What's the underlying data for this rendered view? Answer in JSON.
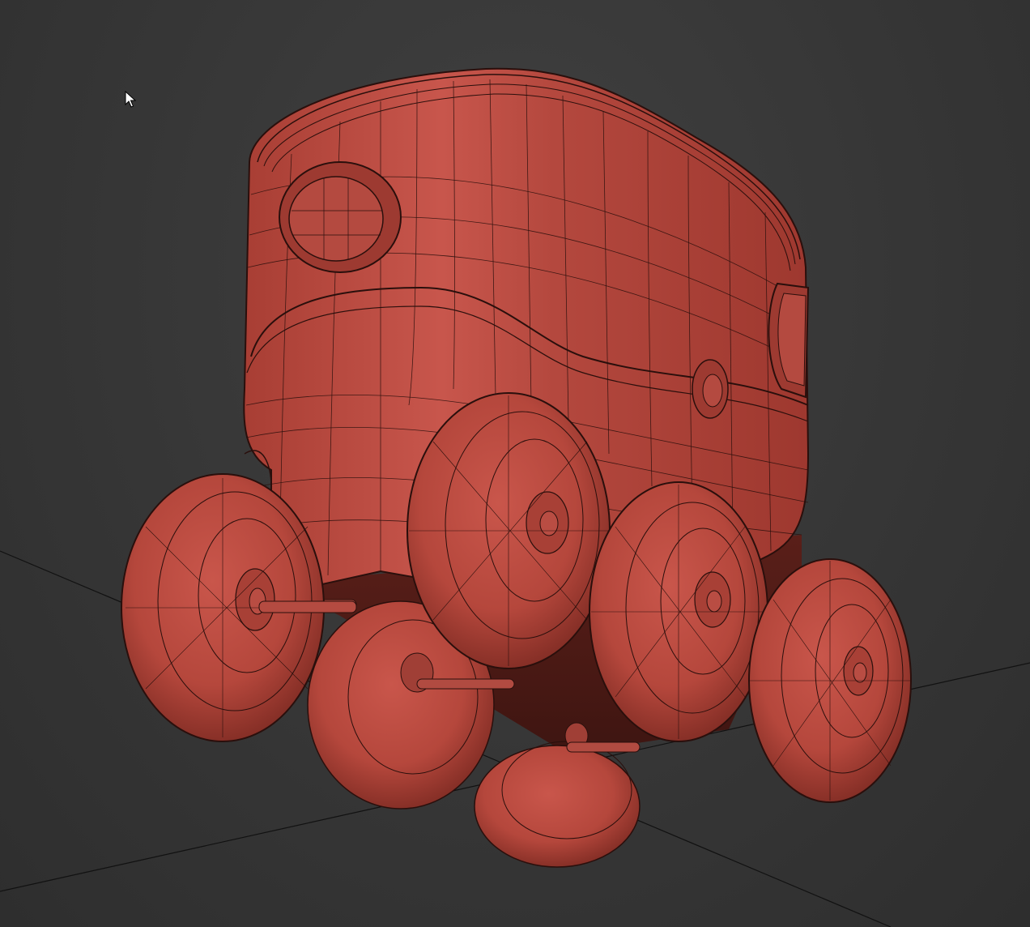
{
  "viewport": {
    "background_color": "#383838",
    "grid_line_color": "#111111",
    "model_color": "#c0463a",
    "wire_color": "#2a0f0c",
    "shade_color": "#8c2d24",
    "highlight_color": "#d4645a"
  },
  "cursor": {
    "icon": "arrow-cursor-icon"
  },
  "model": {
    "icon": "robot-mesh"
  }
}
